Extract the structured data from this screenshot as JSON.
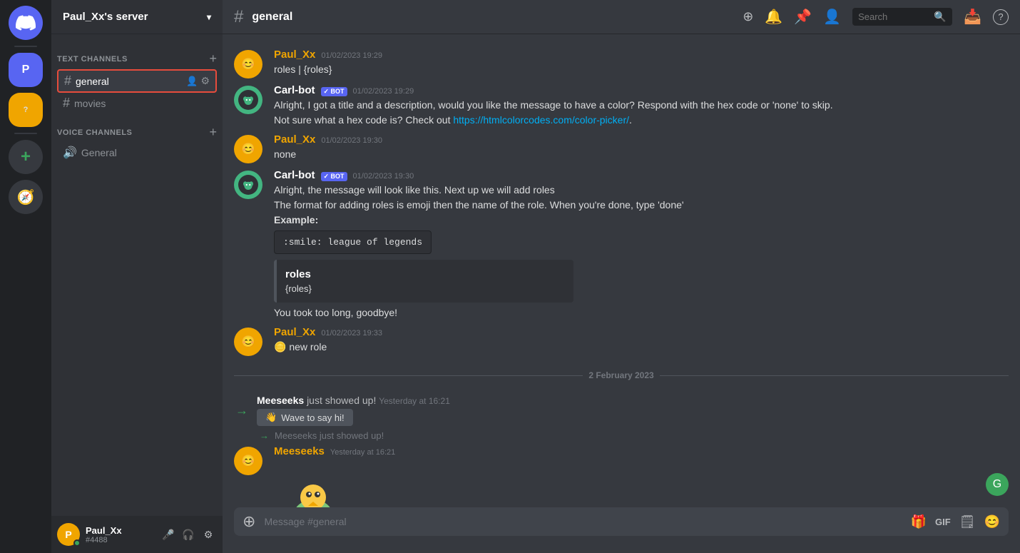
{
  "app": {
    "title": "Discord"
  },
  "server_list": {
    "discord_icon": "D",
    "user_server_label": "P",
    "servers": [
      {
        "id": "discord",
        "label": "D",
        "color": "#5865f2"
      },
      {
        "id": "user",
        "label": "P",
        "color": "#5865f2"
      },
      {
        "id": "server3",
        "label": "?",
        "color": "#f0a500"
      }
    ],
    "add_label": "+",
    "discover_label": "🧭"
  },
  "sidebar": {
    "server_name": "Paul_Xx's server",
    "text_channels_label": "TEXT CHANNELS",
    "voice_channels_label": "VOICE CHANNELS",
    "channels": [
      {
        "id": "general",
        "name": "general",
        "active": true
      },
      {
        "id": "movies",
        "name": "movies",
        "active": false
      }
    ],
    "voice_channels": [
      {
        "id": "general-voice",
        "name": "General"
      }
    ]
  },
  "user_area": {
    "name": "Paul_Xx",
    "tag": "#4488"
  },
  "chat": {
    "channel_name": "general",
    "search_placeholder": "Search",
    "messages": [
      {
        "id": "msg1",
        "author": "Paul_Xx",
        "author_color": "orange",
        "timestamp": "01/02/2023 19:29",
        "text": "roles | {roles}",
        "is_bot": false
      },
      {
        "id": "msg2",
        "author": "Carl-bot",
        "author_color": "carlbot",
        "timestamp": "01/02/2023 19:29",
        "is_bot": true,
        "text_lines": [
          "Alright, I got a title and a description, would you like the message to have a color? Respond with the hex code or 'none' to skip.",
          "Not sure what a hex code is? Check out "
        ],
        "link": "https://htmlcolorcodes.com/color-picker/",
        "link_text": "https://htmlcolorcodes.com/color-picker/"
      },
      {
        "id": "msg3",
        "author": "Paul_Xx",
        "author_color": "orange",
        "timestamp": "01/02/2023 19:30",
        "text": "none",
        "is_bot": false
      },
      {
        "id": "msg4",
        "author": "Carl-bot",
        "author_color": "carlbot",
        "timestamp": "01/02/2023 19:30",
        "is_bot": true,
        "text_lines": [
          "Alright, the message will look like this. Next up we will add roles",
          "The format for adding roles is emoji then the name of the role. When you're done, type 'done'"
        ],
        "example_label": "Example:",
        "code_block": ":smile: league of legends",
        "embed_title": "roles",
        "embed_desc": "{roles}",
        "embed_footer": "You took too long, goodbye!"
      },
      {
        "id": "msg5",
        "author": "Paul_Xx",
        "author_color": "orange",
        "timestamp": "01/02/2023 19:33",
        "text": "🪙 new role",
        "is_bot": false
      }
    ],
    "date_divider": "2 February 2023",
    "join_message": {
      "user": "Meeseeks",
      "text": "just showed up!",
      "time": "Yesterday at 16:21",
      "wave_button": "Wave to say hi!"
    },
    "meeseeks_message": {
      "author": "Meeseeks",
      "timestamp": "Yesterday at 16:21",
      "join_prefix": "→ Meeseeks just showed up!"
    },
    "message_input_placeholder": "Message #general"
  },
  "header_actions": {
    "boost_icon": "⊕",
    "bell_icon": "🔔",
    "pin_icon": "📌",
    "members_icon": "👥",
    "search_label": "Search",
    "inbox_icon": "📥",
    "help_icon": "?"
  }
}
